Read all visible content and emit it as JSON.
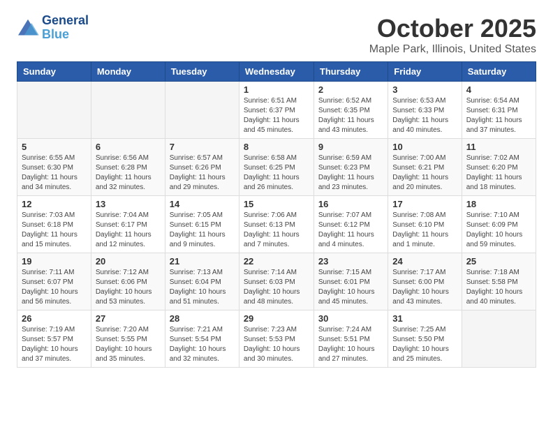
{
  "logo": {
    "line1": "General",
    "line2": "Blue"
  },
  "title": "October 2025",
  "location": "Maple Park, Illinois, United States",
  "weekdays": [
    "Sunday",
    "Monday",
    "Tuesday",
    "Wednesday",
    "Thursday",
    "Friday",
    "Saturday"
  ],
  "weeks": [
    [
      {
        "day": "",
        "info": ""
      },
      {
        "day": "",
        "info": ""
      },
      {
        "day": "",
        "info": ""
      },
      {
        "day": "1",
        "info": "Sunrise: 6:51 AM\nSunset: 6:37 PM\nDaylight: 11 hours and 45 minutes."
      },
      {
        "day": "2",
        "info": "Sunrise: 6:52 AM\nSunset: 6:35 PM\nDaylight: 11 hours and 43 minutes."
      },
      {
        "day": "3",
        "info": "Sunrise: 6:53 AM\nSunset: 6:33 PM\nDaylight: 11 hours and 40 minutes."
      },
      {
        "day": "4",
        "info": "Sunrise: 6:54 AM\nSunset: 6:31 PM\nDaylight: 11 hours and 37 minutes."
      }
    ],
    [
      {
        "day": "5",
        "info": "Sunrise: 6:55 AM\nSunset: 6:30 PM\nDaylight: 11 hours and 34 minutes."
      },
      {
        "day": "6",
        "info": "Sunrise: 6:56 AM\nSunset: 6:28 PM\nDaylight: 11 hours and 32 minutes."
      },
      {
        "day": "7",
        "info": "Sunrise: 6:57 AM\nSunset: 6:26 PM\nDaylight: 11 hours and 29 minutes."
      },
      {
        "day": "8",
        "info": "Sunrise: 6:58 AM\nSunset: 6:25 PM\nDaylight: 11 hours and 26 minutes."
      },
      {
        "day": "9",
        "info": "Sunrise: 6:59 AM\nSunset: 6:23 PM\nDaylight: 11 hours and 23 minutes."
      },
      {
        "day": "10",
        "info": "Sunrise: 7:00 AM\nSunset: 6:21 PM\nDaylight: 11 hours and 20 minutes."
      },
      {
        "day": "11",
        "info": "Sunrise: 7:02 AM\nSunset: 6:20 PM\nDaylight: 11 hours and 18 minutes."
      }
    ],
    [
      {
        "day": "12",
        "info": "Sunrise: 7:03 AM\nSunset: 6:18 PM\nDaylight: 11 hours and 15 minutes."
      },
      {
        "day": "13",
        "info": "Sunrise: 7:04 AM\nSunset: 6:17 PM\nDaylight: 11 hours and 12 minutes."
      },
      {
        "day": "14",
        "info": "Sunrise: 7:05 AM\nSunset: 6:15 PM\nDaylight: 11 hours and 9 minutes."
      },
      {
        "day": "15",
        "info": "Sunrise: 7:06 AM\nSunset: 6:13 PM\nDaylight: 11 hours and 7 minutes."
      },
      {
        "day": "16",
        "info": "Sunrise: 7:07 AM\nSunset: 6:12 PM\nDaylight: 11 hours and 4 minutes."
      },
      {
        "day": "17",
        "info": "Sunrise: 7:08 AM\nSunset: 6:10 PM\nDaylight: 11 hours and 1 minute."
      },
      {
        "day": "18",
        "info": "Sunrise: 7:10 AM\nSunset: 6:09 PM\nDaylight: 10 hours and 59 minutes."
      }
    ],
    [
      {
        "day": "19",
        "info": "Sunrise: 7:11 AM\nSunset: 6:07 PM\nDaylight: 10 hours and 56 minutes."
      },
      {
        "day": "20",
        "info": "Sunrise: 7:12 AM\nSunset: 6:06 PM\nDaylight: 10 hours and 53 minutes."
      },
      {
        "day": "21",
        "info": "Sunrise: 7:13 AM\nSunset: 6:04 PM\nDaylight: 10 hours and 51 minutes."
      },
      {
        "day": "22",
        "info": "Sunrise: 7:14 AM\nSunset: 6:03 PM\nDaylight: 10 hours and 48 minutes."
      },
      {
        "day": "23",
        "info": "Sunrise: 7:15 AM\nSunset: 6:01 PM\nDaylight: 10 hours and 45 minutes."
      },
      {
        "day": "24",
        "info": "Sunrise: 7:17 AM\nSunset: 6:00 PM\nDaylight: 10 hours and 43 minutes."
      },
      {
        "day": "25",
        "info": "Sunrise: 7:18 AM\nSunset: 5:58 PM\nDaylight: 10 hours and 40 minutes."
      }
    ],
    [
      {
        "day": "26",
        "info": "Sunrise: 7:19 AM\nSunset: 5:57 PM\nDaylight: 10 hours and 37 minutes."
      },
      {
        "day": "27",
        "info": "Sunrise: 7:20 AM\nSunset: 5:55 PM\nDaylight: 10 hours and 35 minutes."
      },
      {
        "day": "28",
        "info": "Sunrise: 7:21 AM\nSunset: 5:54 PM\nDaylight: 10 hours and 32 minutes."
      },
      {
        "day": "29",
        "info": "Sunrise: 7:23 AM\nSunset: 5:53 PM\nDaylight: 10 hours and 30 minutes."
      },
      {
        "day": "30",
        "info": "Sunrise: 7:24 AM\nSunset: 5:51 PM\nDaylight: 10 hours and 27 minutes."
      },
      {
        "day": "31",
        "info": "Sunrise: 7:25 AM\nSunset: 5:50 PM\nDaylight: 10 hours and 25 minutes."
      },
      {
        "day": "",
        "info": ""
      }
    ]
  ]
}
